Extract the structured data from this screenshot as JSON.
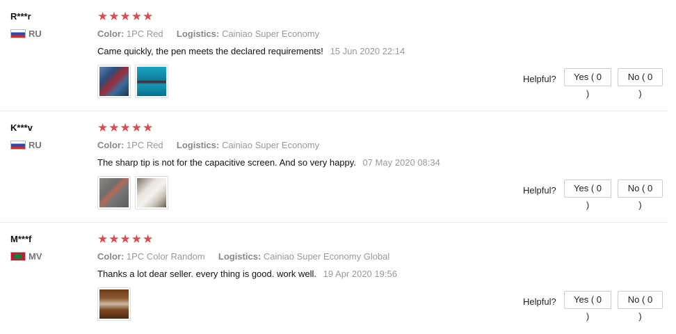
{
  "helpful_label": "Helpful?",
  "stars": "★★★★★",
  "reviews": [
    {
      "user": "R***r",
      "country": "RU",
      "flag": "russia-flag",
      "rating": 5,
      "color_label": "Color:",
      "color_value": "1PC Red",
      "logistics_label": "Logistics:",
      "logistics_value": "Cainiao Super Economy",
      "comment": "Came quickly, the pen meets the declared requirements!",
      "date": "15 Jun 2020 22:14",
      "yes": "Yes ( 0 )",
      "no": "No ( 0 )"
    },
    {
      "user": "K***v",
      "country": "RU",
      "flag": "russia-flag",
      "rating": 5,
      "color_label": "Color:",
      "color_value": "1PC Red",
      "logistics_label": "Logistics:",
      "logistics_value": "Cainiao Super Economy",
      "comment": "The sharp tip is not for the capacitive screen. And so very happy.",
      "date": "07 May 2020 08:34",
      "yes": "Yes ( 0 )",
      "no": "No ( 0 )"
    },
    {
      "user": "M***f",
      "country": "MV",
      "flag": "maldives-flag",
      "rating": 5,
      "color_label": "Color:",
      "color_value": "1PC Color Random",
      "logistics_label": "Logistics:",
      "logistics_value": "Cainiao Super Economy Global",
      "comment": "Thanks a lot dear seller. every thing is good. work well.",
      "date": "19 Apr 2020 19:56",
      "yes": "Yes ( 0 )",
      "no": "No ( 0 )"
    }
  ],
  "colors": {
    "star": "#e24b4b",
    "muted": "#999999"
  }
}
